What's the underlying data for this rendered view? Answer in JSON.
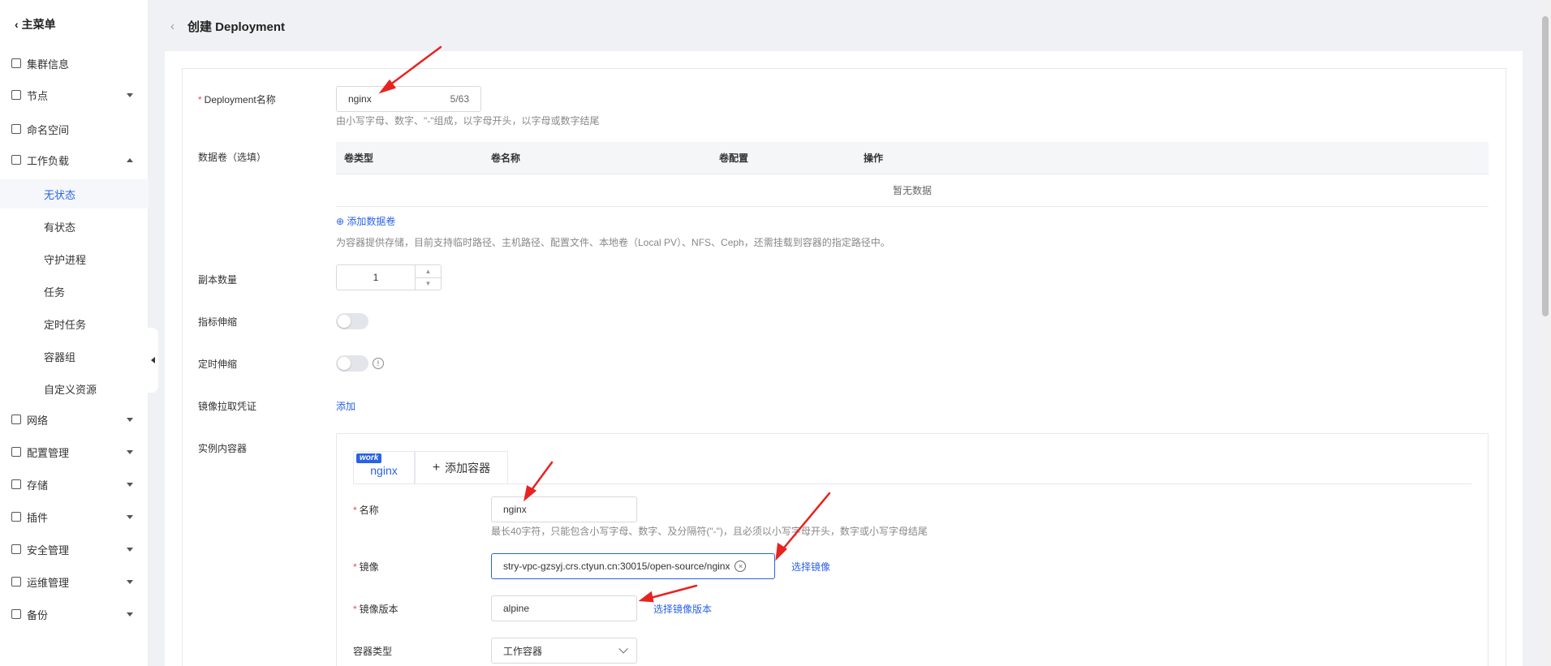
{
  "sidebar": {
    "back_label": "主菜单",
    "items": [
      {
        "label": "集群信息"
      },
      {
        "label": "节点"
      },
      {
        "label": "命名空间"
      },
      {
        "label": "工作负载"
      }
    ],
    "sub_items": [
      {
        "label": "无状态"
      },
      {
        "label": "有状态"
      },
      {
        "label": "守护进程"
      },
      {
        "label": "任务"
      },
      {
        "label": "定时任务"
      },
      {
        "label": "容器组"
      },
      {
        "label": "自定义资源"
      }
    ],
    "bottom_items": [
      {
        "label": "网络"
      },
      {
        "label": "配置管理"
      },
      {
        "label": "存储"
      },
      {
        "label": "插件"
      },
      {
        "label": "安全管理"
      },
      {
        "label": "运维管理"
      },
      {
        "label": "备份"
      }
    ]
  },
  "header": {
    "title": "创建 Deployment"
  },
  "form": {
    "deployment_name_label": "Deployment名称",
    "deployment_name_value": "nginx",
    "deployment_name_count": "5/63",
    "deployment_name_help": "由小写字母、数字、\"-\"组成，以字母开头，以字母或数字结尾",
    "volume_label": "数据卷（选填）",
    "volume_columns": [
      "卷类型",
      "卷名称",
      "卷配置",
      "操作"
    ],
    "volume_empty": "暂无数据",
    "add_volume": "添加数据卷",
    "volume_help": "为容器提供存储，目前支持临时路径、主机路径、配置文件、本地卷（Local PV）、NFS、Ceph，还需挂载到容器的指定路径中。",
    "replicas_label": "副本数量",
    "replicas_value": "1",
    "metric_scaling_label": "指标伸缩",
    "timed_scaling_label": "定时伸缩",
    "pull_secret_label": "镜像拉取凭证",
    "pull_secret_add": "添加",
    "containers_label": "实例内容器"
  },
  "container": {
    "tab_badge": "work",
    "tab_name": "nginx",
    "add_container": "添加容器",
    "name_label": "名称",
    "name_value": "nginx",
    "name_help": "最长40字符，只能包含小写字母、数字、及分隔符(\"-\")，且必须以小写字母开头，数字或小写字母结尾",
    "image_label": "镜像",
    "image_value": "stry-vpc-gzsyj.crs.ctyun.cn:30015/open-source/nginx",
    "select_image": "选择镜像",
    "image_version_label": "镜像版本",
    "image_version_value": "alpine",
    "select_image_version": "选择镜像版本",
    "container_type_label": "容器类型",
    "container_type_value": "工作容器"
  },
  "colors": {
    "accent": "#2a62e6",
    "required": "#e34d59",
    "annotation": "#e8231f"
  }
}
